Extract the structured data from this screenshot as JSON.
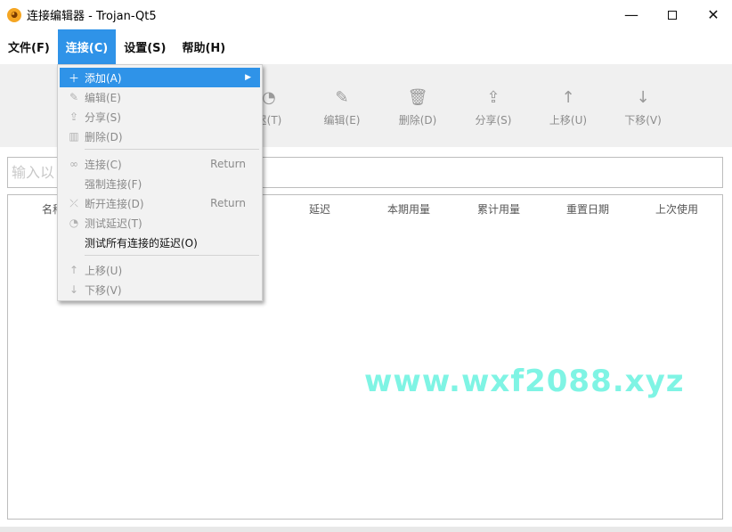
{
  "window": {
    "title": "连接编辑器 - Trojan-Qt5",
    "icon": "trojan-qt5-app-icon"
  },
  "window_controls": {
    "minimize": "—",
    "close": "✕"
  },
  "menubar": [
    {
      "label": "文件(F)"
    },
    {
      "label": "连接(C)",
      "active": true
    },
    {
      "label": "设置(S)"
    },
    {
      "label": "帮助(H)"
    }
  ],
  "toolbar": [
    {
      "label": "迟(T)",
      "icon": "speed-icon"
    },
    {
      "label": "编辑(E)",
      "icon": "edit-icon"
    },
    {
      "label": "删除(D)",
      "icon": "trash-icon"
    },
    {
      "label": "分享(S)",
      "icon": "share-icon"
    },
    {
      "label": "上移(U)",
      "icon": "arrow-up-icon"
    },
    {
      "label": "下移(V)",
      "icon": "arrow-down-icon"
    }
  ],
  "search": {
    "placeholder": "输入以"
  },
  "table": {
    "columns": [
      "名称",
      "延迟",
      "本期用量",
      "累计用量",
      "重置日期",
      "上次使用"
    ]
  },
  "dropdown": {
    "items": [
      {
        "label": "添加(A)",
        "icon": "plus-icon",
        "shortcut": "",
        "submenu": true,
        "highlighted": true
      },
      {
        "label": "编辑(E)",
        "icon": "edit-icon",
        "shortcut": ""
      },
      {
        "label": "分享(S)",
        "icon": "share-icon",
        "shortcut": ""
      },
      {
        "label": "删除(D)",
        "icon": "trash-icon",
        "shortcut": ""
      },
      {
        "label": "连接(C)",
        "icon": "link-icon",
        "shortcut": "Return"
      },
      {
        "label": "强制连接(F)",
        "icon": "",
        "shortcut": ""
      },
      {
        "label": "断开连接(D)",
        "icon": "unlink-icon",
        "shortcut": "Return"
      },
      {
        "label": "测试延迟(T)",
        "icon": "speed-icon",
        "shortcut": ""
      },
      {
        "label": "测试所有连接的延迟(O)",
        "icon": "",
        "shortcut": "",
        "enabled": true
      },
      {
        "label": "上移(U)",
        "icon": "arrow-up-icon",
        "shortcut": ""
      },
      {
        "label": "下移(V)",
        "icon": "arrow-down-icon",
        "shortcut": ""
      }
    ],
    "submenu_arrow": "▶"
  },
  "watermark": "www.wxf2088.xyz",
  "colors": {
    "accent": "#2f93e8",
    "watermark": "#7ff4e4",
    "toolbar_bg": "#f0f0f0"
  }
}
